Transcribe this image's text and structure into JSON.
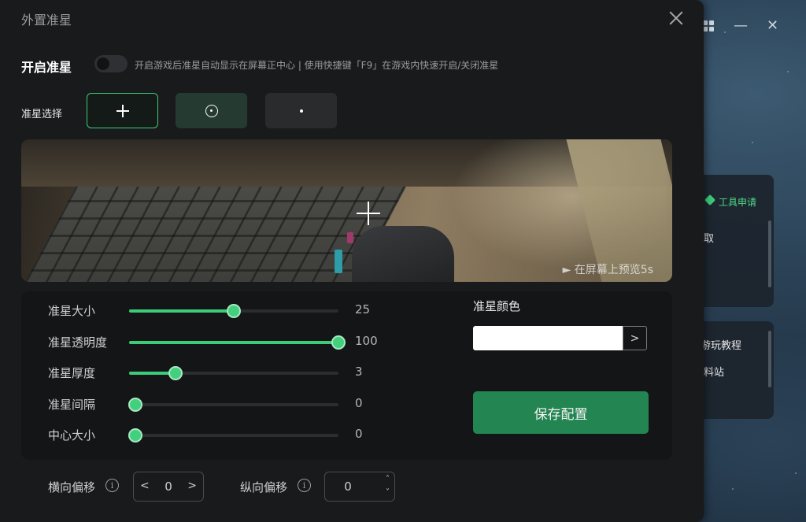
{
  "dialog": {
    "title": "外置准星",
    "enable_label": "开启准星",
    "enable_on": false,
    "enable_hint": "开启游戏后准星自动显示在屏幕正中心 | 使用快捷键「F9」在游戏内快速开启/关闭准星",
    "select_label": "准星选择",
    "styles": [
      {
        "glyph": "+",
        "selected": true
      },
      {
        "glyph": "⊙",
        "selected": false
      },
      {
        "glyph": "•",
        "selected": false
      }
    ],
    "preview_link": "► 在屏幕上预览5s"
  },
  "sliders": [
    {
      "label": "准星大小",
      "value": "25",
      "fraction": 0.5
    },
    {
      "label": "准星透明度",
      "value": "100",
      "fraction": 1.0
    },
    {
      "label": "准星厚度",
      "value": "3",
      "fraction": 0.22
    },
    {
      "label": "准星间隔",
      "value": "0",
      "fraction": 0.03
    },
    {
      "label": "中心大小",
      "value": "0",
      "fraction": 0.03
    }
  ],
  "color": {
    "label": "准星颜色",
    "value": "#ffffff",
    "btn_glyph": ">"
  },
  "save_label": "保存配置",
  "offsets": {
    "horizontal_label": "横向偏移",
    "horizontal_value": "0",
    "vertical_label": "纵向偏移",
    "vertical_value": "0",
    "info_glyph": "i",
    "left_glyph": "<",
    "right_glyph": ">",
    "up_glyph": "˄",
    "down_glyph": "˅"
  },
  "background_app": {
    "tool_apply": "工具申请",
    "item_1": "取",
    "item_2": "游玩教程",
    "item_3": "料站",
    "min_glyph": "—",
    "close_glyph": "✕",
    "accent": "#3ccc78"
  }
}
